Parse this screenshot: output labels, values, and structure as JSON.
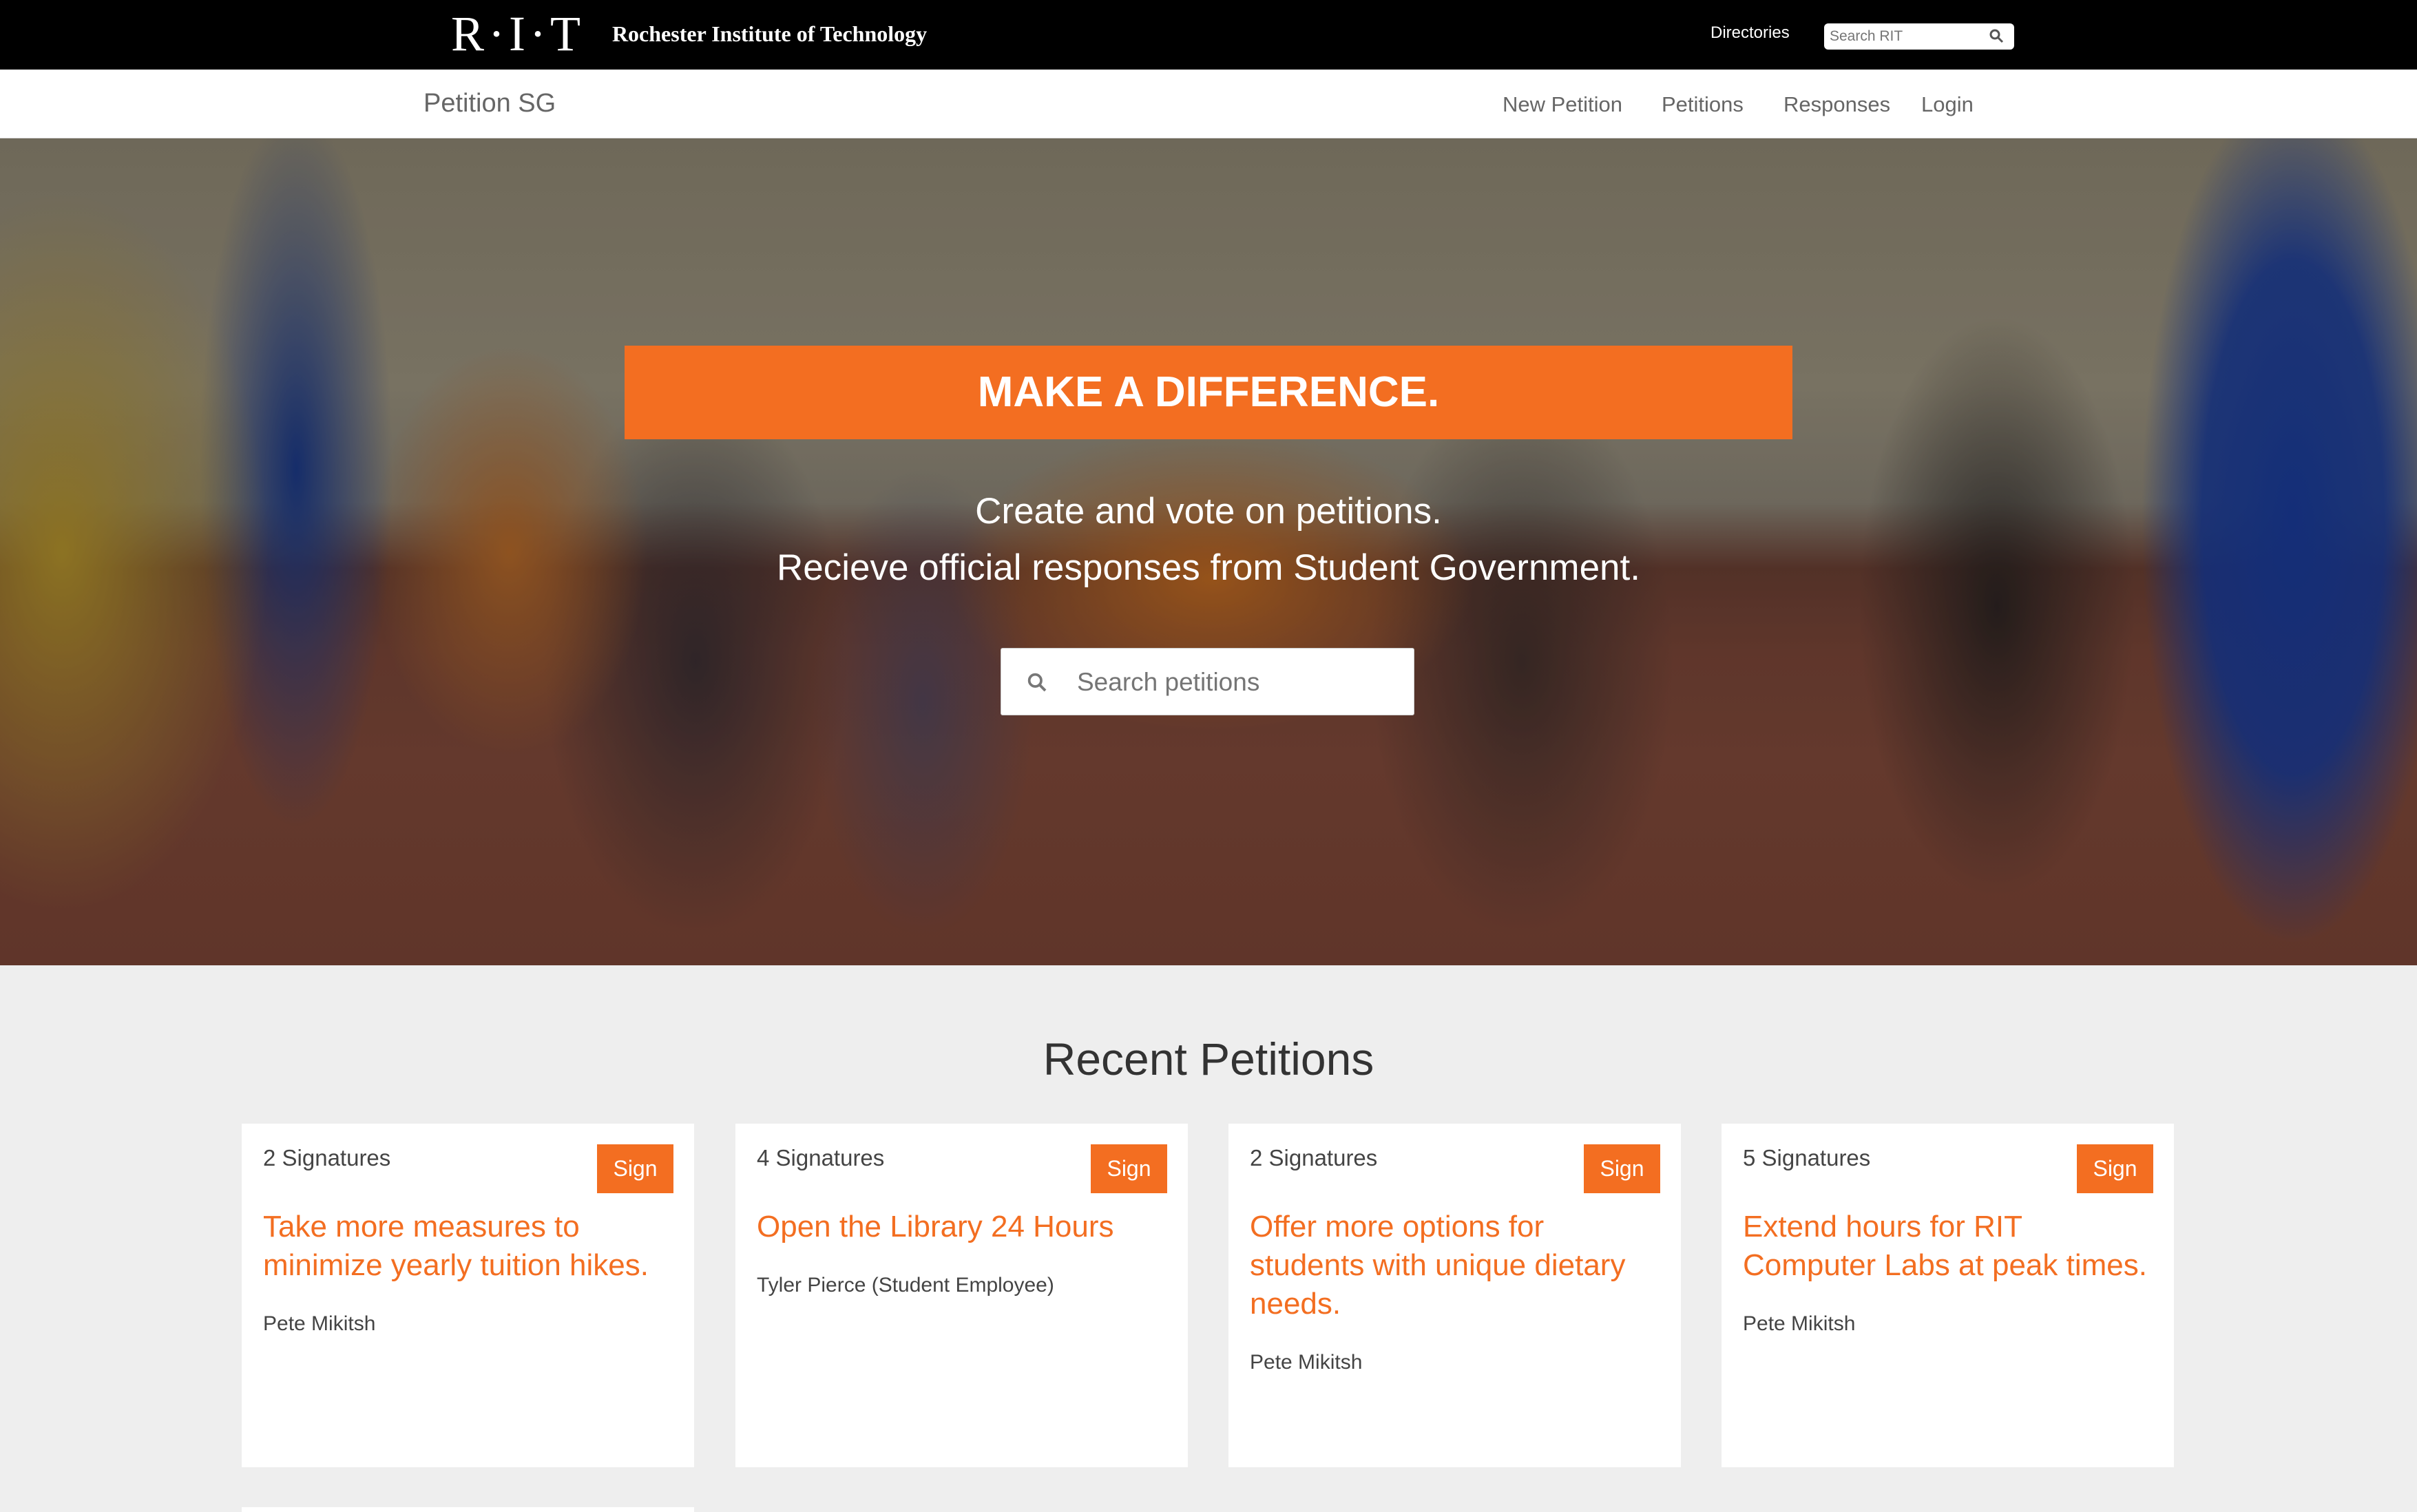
{
  "rit_bar": {
    "logo_mark": "R·I·T",
    "logo_name": "Rochester Institute of Technology",
    "directories_label": "Directories",
    "search_placeholder": "Search RIT",
    "search_icon": "magnifier-icon"
  },
  "nav": {
    "brand": "Petition SG",
    "links": [
      {
        "label": "New Petition"
      },
      {
        "label": "Petitions"
      },
      {
        "label": "Responses"
      },
      {
        "label": "Login"
      }
    ]
  },
  "hero": {
    "banner": "MAKE A DIFFERENCE.",
    "line1": "Create and vote on petitions.",
    "line2": "Recieve official responses from Student Government.",
    "search_placeholder": "Search petitions",
    "search_icon": "magnifier-icon"
  },
  "recent": {
    "title": "Recent Petitions",
    "cards": [
      {
        "signatures": "2 Signatures",
        "sign_label": "Sign",
        "title": "Take more measures to minimize yearly tuition hikes.",
        "author": "Pete Mikitsh"
      },
      {
        "signatures": "4 Signatures",
        "sign_label": "Sign",
        "title": "Open the Library 24 Hours",
        "author": "Tyler Pierce (Student Employee)"
      },
      {
        "signatures": "2 Signatures",
        "sign_label": "Sign",
        "title": "Offer more options for students with unique dietary needs.",
        "author": "Pete Mikitsh"
      },
      {
        "signatures": "5 Signatures",
        "sign_label": "Sign",
        "title": "Extend hours for RIT Computer Labs at peak times.",
        "author": "Pete Mikitsh"
      }
    ]
  },
  "colors": {
    "accent": "#f36e21",
    "top_bar": "#000000",
    "background": "#eeeeee"
  }
}
